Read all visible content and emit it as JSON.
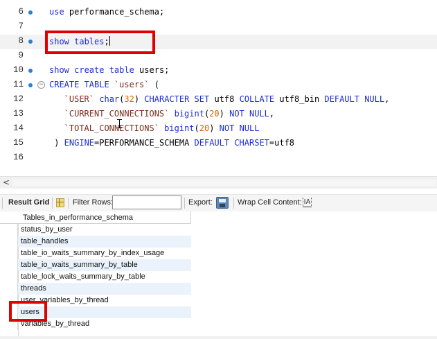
{
  "editor": {
    "lines": [
      {
        "num": "6",
        "marker": true,
        "fold": false,
        "indent": 0,
        "tokens": [
          {
            "t": "use ",
            "c": "kw"
          },
          {
            "t": "performance_schema;",
            "c": ""
          }
        ]
      },
      {
        "num": "7",
        "marker": false,
        "fold": false,
        "indent": 0,
        "tokens": []
      },
      {
        "num": "8",
        "marker": true,
        "fold": false,
        "indent": 0,
        "current": true,
        "caret": true,
        "tokens": [
          {
            "t": "show tables",
            "c": "kw"
          },
          {
            "t": ";",
            "c": ""
          }
        ]
      },
      {
        "num": "9",
        "marker": false,
        "fold": false,
        "indent": 0,
        "tokens": []
      },
      {
        "num": "10",
        "marker": true,
        "fold": false,
        "indent": 0,
        "tokens": [
          {
            "t": "show create table ",
            "c": "kw"
          },
          {
            "t": "users;",
            "c": ""
          }
        ]
      },
      {
        "num": "11",
        "marker": true,
        "fold": true,
        "indent": 0,
        "tokens": [
          {
            "t": "CREATE TABLE ",
            "c": "kw"
          },
          {
            "t": "`users`",
            "c": "ident"
          },
          {
            "t": " (",
            "c": ""
          }
        ]
      },
      {
        "num": "12",
        "marker": false,
        "fold": false,
        "indent": 3,
        "tokens": [
          {
            "t": "`USER`",
            "c": "ident"
          },
          {
            "t": " ",
            "c": ""
          },
          {
            "t": "char",
            "c": "kw"
          },
          {
            "t": "(",
            "c": ""
          },
          {
            "t": "32",
            "c": "num"
          },
          {
            "t": ") ",
            "c": ""
          },
          {
            "t": "CHARACTER SET ",
            "c": "kw"
          },
          {
            "t": "utf8 ",
            "c": ""
          },
          {
            "t": "COLLATE ",
            "c": "kw"
          },
          {
            "t": "utf8_bin ",
            "c": ""
          },
          {
            "t": "DEFAULT NULL",
            "c": "kw"
          },
          {
            "t": ",",
            "c": ""
          }
        ]
      },
      {
        "num": "13",
        "marker": false,
        "fold": false,
        "indent": 3,
        "tokens": [
          {
            "t": "`CURRENT_CONNECTIONS`",
            "c": "ident"
          },
          {
            "t": " ",
            "c": ""
          },
          {
            "t": "bigint",
            "c": "kw"
          },
          {
            "t": "(",
            "c": ""
          },
          {
            "t": "20",
            "c": "num"
          },
          {
            "t": ") ",
            "c": ""
          },
          {
            "t": "NOT NULL",
            "c": "kw"
          },
          {
            "t": ",",
            "c": ""
          }
        ]
      },
      {
        "num": "14",
        "marker": false,
        "fold": false,
        "indent": 3,
        "tokens": [
          {
            "t": "`TOTAL_CONNECTIONS`",
            "c": "ident"
          },
          {
            "t": " ",
            "c": ""
          },
          {
            "t": "bigint",
            "c": "kw"
          },
          {
            "t": "(",
            "c": ""
          },
          {
            "t": "20",
            "c": "num"
          },
          {
            "t": ") ",
            "c": ""
          },
          {
            "t": "NOT NULL",
            "c": "kw"
          }
        ]
      },
      {
        "num": "15",
        "marker": false,
        "fold": false,
        "indent": 1,
        "tokens": [
          {
            "t": ") ",
            "c": ""
          },
          {
            "t": "ENGINE",
            "c": "kw"
          },
          {
            "t": "=PERFORMANCE_SCHEMA ",
            "c": ""
          },
          {
            "t": "DEFAULT CHARSET",
            "c": "kw"
          },
          {
            "t": "=utf8",
            "c": ""
          }
        ]
      },
      {
        "num": "16",
        "marker": false,
        "fold": false,
        "indent": 0,
        "tokens": []
      }
    ]
  },
  "toolbar": {
    "result_grid_label": "Result Grid",
    "filter_rows_label": "Filter Rows:",
    "filter_value": "",
    "export_label": "Export:",
    "wrap_label": "Wrap Cell Content:",
    "wrap_icon_glyph": "IA"
  },
  "scroll": {
    "left_glyph": "<"
  },
  "grid": {
    "column_header": "Tables_in_performance_schema",
    "rows": [
      "status_by_user",
      "table_handles",
      "table_io_waits_summary_by_index_usage",
      "table_io_waits_summary_by_table",
      "table_lock_waits_summary_by_table",
      "threads",
      "user_variables_by_thread",
      "users",
      "variables_by_thread"
    ]
  },
  "colors": {
    "keyword": "#1c2bd6",
    "number": "#d26500",
    "identifier": "#7a2f1f",
    "annotation": "#e00000",
    "row_alt": "#eaf2fb",
    "marker": "#2d7fd3"
  }
}
